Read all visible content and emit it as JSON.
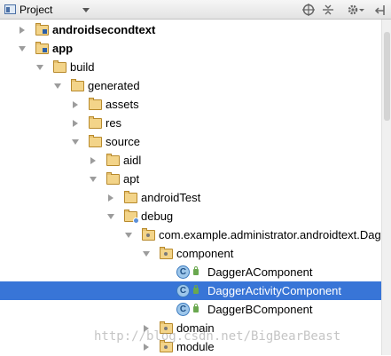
{
  "header": {
    "title": "Project",
    "toolbar_icons": [
      "target-icon",
      "collapse-all-icon",
      "gear-icon",
      "hide-panel-icon"
    ]
  },
  "tree": [
    {
      "label": "androidsecondtext",
      "state": "collapsed",
      "icon": "module-folder-icon",
      "bold": true
    },
    {
      "label": "app",
      "state": "expanded",
      "icon": "module-folder-icon",
      "bold": true
    },
    {
      "label": "build",
      "state": "expanded",
      "icon": "folder-icon"
    },
    {
      "label": "generated",
      "state": "expanded",
      "icon": "folder-icon"
    },
    {
      "label": "assets",
      "state": "collapsed",
      "icon": "folder-icon"
    },
    {
      "label": "res",
      "state": "collapsed",
      "icon": "folder-icon"
    },
    {
      "label": "source",
      "state": "expanded",
      "icon": "folder-icon"
    },
    {
      "label": "aidl",
      "state": "collapsed",
      "icon": "folder-icon"
    },
    {
      "label": "apt",
      "state": "expanded",
      "icon": "folder-icon"
    },
    {
      "label": "androidTest",
      "state": "collapsed",
      "icon": "folder-icon"
    },
    {
      "label": "debug",
      "state": "expanded",
      "icon": "generated-source-folder-icon"
    },
    {
      "label": "com.example.administrator.androidtext.Dagg",
      "state": "expanded",
      "icon": "package-icon"
    },
    {
      "label": "component",
      "state": "expanded",
      "icon": "package-icon"
    },
    {
      "label": "DaggerAComponent",
      "state": "leaf",
      "icon": "class-icon"
    },
    {
      "label": "DaggerActivityComponent",
      "state": "leaf",
      "icon": "class-icon",
      "selected": true
    },
    {
      "label": "DaggerBComponent",
      "state": "leaf",
      "icon": "class-icon"
    },
    {
      "label": "domain",
      "state": "collapsed",
      "icon": "package-icon"
    },
    {
      "label": "module",
      "state": "collapsed",
      "icon": "package-icon"
    }
  ],
  "watermark": "http://blog.csdn.net/BigBearBeast",
  "colors": {
    "selection": "#3875d7",
    "header_bg": "#e8e8e8",
    "folder": "#f3d489"
  }
}
